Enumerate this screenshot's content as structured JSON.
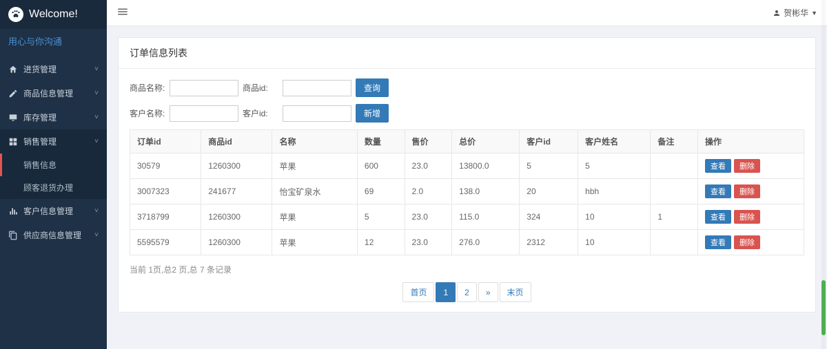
{
  "brand": {
    "title": "Welcome!",
    "tagline": "用心与你沟通"
  },
  "user": {
    "name": "贺彬华"
  },
  "sidebar": {
    "items": [
      {
        "label": "进货管理",
        "icon": "home"
      },
      {
        "label": "商品信息管理",
        "icon": "edit"
      },
      {
        "label": "库存管理",
        "icon": "monitor"
      },
      {
        "label": "销售管理",
        "icon": "grid",
        "children": [
          {
            "label": "销售信息",
            "active": true
          },
          {
            "label": "顾客退货办理"
          }
        ]
      },
      {
        "label": "客户信息管理",
        "icon": "bars"
      },
      {
        "label": "供应商信息管理",
        "icon": "copy"
      }
    ]
  },
  "panel": {
    "title": "订单信息列表"
  },
  "filters": {
    "row1": {
      "label1": "商品名称:",
      "label2": "商品id:",
      "button": "查询"
    },
    "row2": {
      "label1": "客户名称:",
      "label2": "客户id:",
      "button": "新增"
    }
  },
  "table": {
    "headers": [
      "订单id",
      "商品id",
      "名称",
      "数量",
      "售价",
      "总价",
      "客户id",
      "客户姓名",
      "备注",
      "操作"
    ],
    "rows": [
      {
        "cells": [
          "30579",
          "1260300",
          "苹果",
          "600",
          "23.0",
          "13800.0",
          "5",
          "5",
          ""
        ]
      },
      {
        "cells": [
          "3007323",
          "241677",
          "怡宝矿泉水",
          "69",
          "2.0",
          "138.0",
          "20",
          "hbh",
          ""
        ]
      },
      {
        "cells": [
          "3718799",
          "1260300",
          "苹果",
          "5",
          "23.0",
          "115.0",
          "324",
          "10",
          "1"
        ]
      },
      {
        "cells": [
          "5595579",
          "1260300",
          "苹果",
          "12",
          "23.0",
          "276.0",
          "2312",
          "10",
          ""
        ]
      }
    ],
    "ops": {
      "view": "查看",
      "delete": "删除"
    }
  },
  "pagination": {
    "summary": "当前 1页,总2 页,总 7 条记录",
    "first": "首页",
    "last": "末页",
    "pages": [
      "1",
      "2"
    ],
    "next": "»",
    "current": 1
  }
}
